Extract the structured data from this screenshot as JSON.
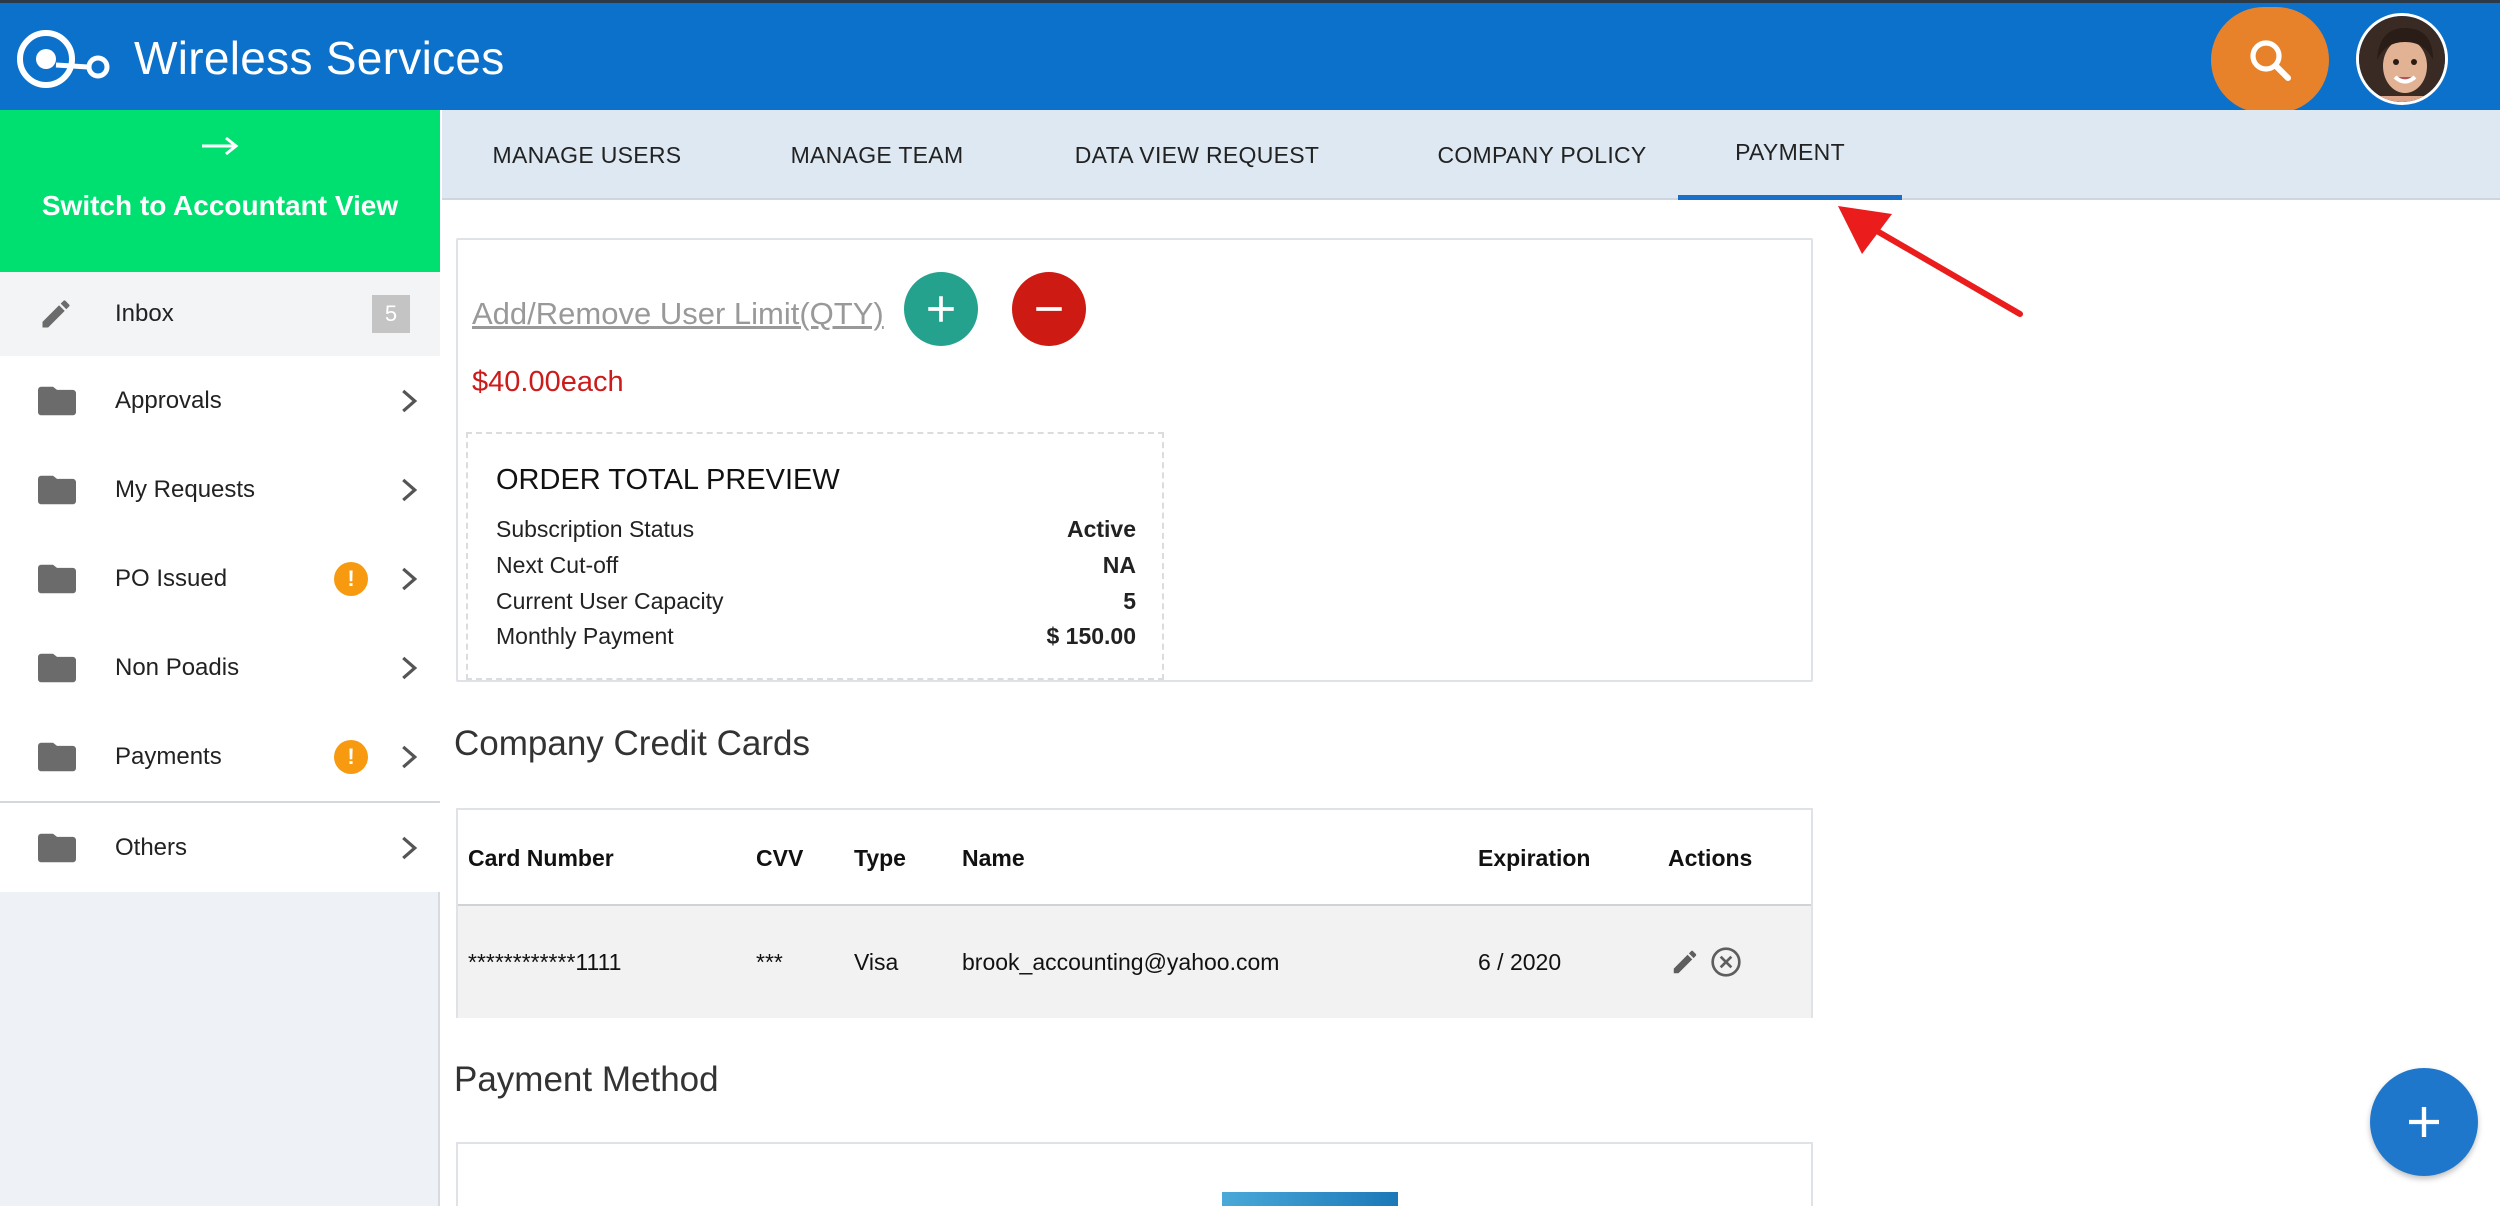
{
  "header": {
    "title": "Wireless Services",
    "search_icon": "search-icon",
    "avatar": "user-avatar"
  },
  "sidebar": {
    "switch_label": "Switch to Accountant View",
    "items": [
      {
        "label": "Inbox",
        "icon": "pencil-icon",
        "count": "5"
      },
      {
        "label": "Approvals",
        "icon": "folder-icon"
      },
      {
        "label": "My Requests",
        "icon": "folder-icon"
      },
      {
        "label": "PO Issued",
        "icon": "folder-icon",
        "alert": "!"
      },
      {
        "label": "Non Poadis",
        "icon": "folder-icon"
      },
      {
        "label": "Payments",
        "icon": "folder-icon",
        "alert": "!"
      },
      {
        "label": "Others",
        "icon": "folder-icon"
      }
    ]
  },
  "tabs": [
    {
      "label": "MANAGE USERS"
    },
    {
      "label": "MANAGE TEAM"
    },
    {
      "label": "DATA VIEW REQUEST"
    },
    {
      "label": "COMPANY POLICY"
    },
    {
      "label": "PAYMENT",
      "active": true
    }
  ],
  "limit": {
    "link_text": "Add/Remove User Limit(QTY)",
    "price": "$40.00each"
  },
  "order_preview": {
    "title": "ORDER TOTAL PREVIEW",
    "rows": [
      {
        "label": "Subscription Status",
        "value": "Active"
      },
      {
        "label": "Next Cut-off",
        "value": "NA"
      },
      {
        "label": "Current User Capacity",
        "value": "5"
      },
      {
        "label": "Monthly Payment",
        "value": "$ 150.00"
      }
    ]
  },
  "credit_cards": {
    "title": "Company Credit Cards",
    "columns": [
      "Card Number",
      "CVV",
      "Type",
      "Name",
      "Expiration",
      "Actions"
    ],
    "rows": [
      {
        "card_number": "************1111",
        "cvv": "***",
        "type": "Visa",
        "name": "brook_accounting@yahoo.com",
        "expiration": "6 / 2020"
      }
    ]
  },
  "payment_method": {
    "title": "Payment Method"
  },
  "colors": {
    "header": "#0c71cb",
    "switch": "#00e071",
    "search": "#e8822a",
    "add": "#24a28d",
    "remove": "#cd1a12",
    "price": "#cc1b1b",
    "alert": "#f79a0f",
    "tab_active": "#1a6fc9",
    "annotation": "#ea1c1c"
  }
}
